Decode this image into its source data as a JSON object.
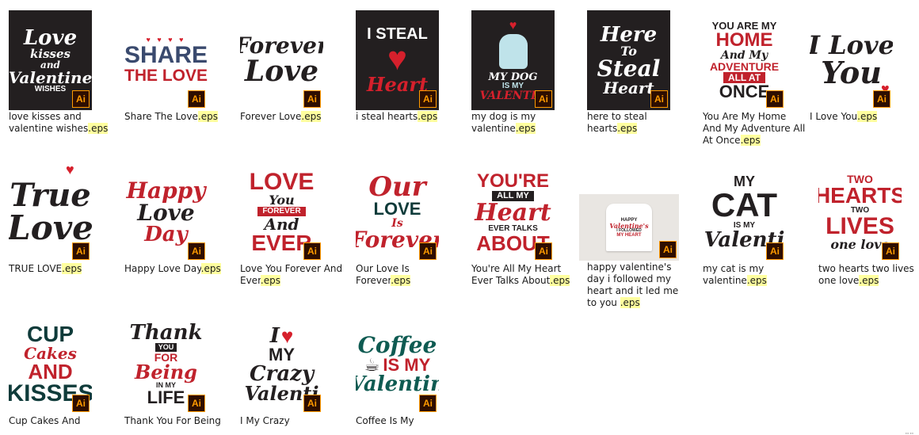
{
  "ext": ".eps",
  "badge": "Ai",
  "files": [
    {
      "name": "love kisses and valentine wishes",
      "art": [
        "Love",
        "kisses",
        "and",
        "Valentine",
        "WISHES"
      ]
    },
    {
      "name": "Share The Love",
      "art": [
        "SHARE",
        "THE LOVE"
      ]
    },
    {
      "name": "Forever Love",
      "art": [
        "Forever",
        "Love"
      ]
    },
    {
      "name": "i steal hearts",
      "art": [
        "I STEAL",
        "Heart"
      ]
    },
    {
      "name": "my dog is my valentine",
      "art": [
        "MY DOG",
        "IS MY",
        "VALENTIN"
      ]
    },
    {
      "name": "here to steal hearts",
      "art": [
        "Here",
        "To",
        "Steal",
        "Heart"
      ]
    },
    {
      "name": "You Are My Home And My Adventure All At Once",
      "art": [
        "YOU ARE MY",
        "HOME",
        "And My",
        "ADVENTURE",
        "ALL AT",
        "ONCE"
      ]
    },
    {
      "name": "I Love You",
      "art": [
        "I Love",
        "You"
      ]
    },
    {
      "name": "TRUE LOVE",
      "art": [
        "True",
        "Love"
      ]
    },
    {
      "name": "Happy Love Day",
      "art": [
        "Happy",
        "Love",
        "Day"
      ]
    },
    {
      "name": "Love You Forever And Ever",
      "art": [
        "LOVE",
        "You",
        "FOREVER",
        "And",
        "EVER"
      ]
    },
    {
      "name": "Our Love Is Forever",
      "art": [
        "Our",
        "LOVE",
        "Is",
        "Forever"
      ]
    },
    {
      "name": "You're All My Heart Ever Talks About",
      "art": [
        "YOU'RE",
        "ALL MY",
        "Heart",
        "EVER TALKS",
        "ABOUT"
      ]
    },
    {
      "name": "happy valentine's day i followed my heart and it led me to you ",
      "art": [
        "HAPPY",
        "Valentine's",
        "I FOLLOWED",
        "MY HEART"
      ]
    },
    {
      "name": "my cat is my valentine",
      "art": [
        "MY",
        "CAT",
        "IS MY",
        "Valenti"
      ]
    },
    {
      "name": "two hearts two lives one love",
      "art": [
        "TWO",
        "HEARTS",
        "TWO",
        "LIVES",
        "one love"
      ]
    },
    {
      "name": "Cup Cakes And",
      "art": [
        "CUP",
        "Cakes",
        "AND",
        "KISSES"
      ]
    },
    {
      "name": "Thank You For Being",
      "art": [
        "Thank",
        "YOU",
        "FOR",
        "Being",
        "IN MY",
        "LIFE"
      ]
    },
    {
      "name": "I My Crazy",
      "art": [
        "I",
        "MY",
        "Crazy",
        "Valenti"
      ]
    },
    {
      "name": "Coffee Is My",
      "art": [
        "Coffee",
        "IS MY",
        "Valentin"
      ]
    }
  ]
}
